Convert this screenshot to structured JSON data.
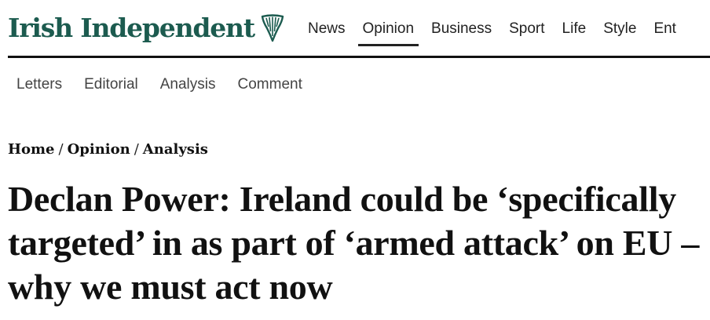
{
  "brand": {
    "name": "Irish Independent",
    "color": "#1c5b4f",
    "logo_icon": "harp-icon"
  },
  "main_nav": {
    "items": [
      {
        "label": "News",
        "active": false
      },
      {
        "label": "Opinion",
        "active": true
      },
      {
        "label": "Business",
        "active": false
      },
      {
        "label": "Sport",
        "active": false
      },
      {
        "label": "Life",
        "active": false
      },
      {
        "label": "Style",
        "active": false
      },
      {
        "label": "Ent",
        "active": false
      }
    ]
  },
  "sub_nav": {
    "items": [
      {
        "label": "Letters"
      },
      {
        "label": "Editorial"
      },
      {
        "label": "Analysis"
      },
      {
        "label": "Comment"
      }
    ]
  },
  "breadcrumb": {
    "items": [
      "Home",
      "Opinion",
      "Analysis"
    ],
    "separator": "/"
  },
  "article": {
    "headline": "Declan Power: Ireland could be ‘specifically targeted’ in as part of ‘armed attack’ on EU – why we must act now"
  }
}
